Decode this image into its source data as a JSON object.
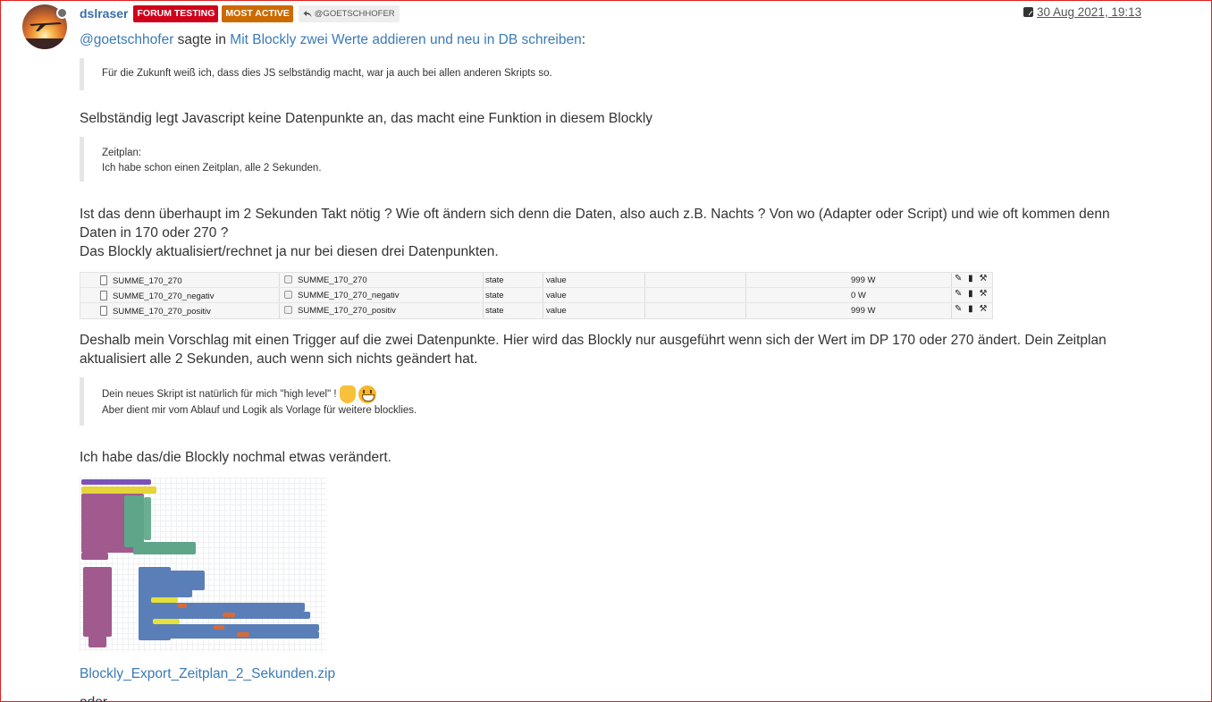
{
  "post": {
    "username": "dslraser",
    "badges": [
      "FORUM TESTING",
      "MOST ACTIVE"
    ],
    "reply_to": "@GOETSCHHOFER",
    "timestamp": "30 Aug 2021, 19:13",
    "mention": "@goetschhofer",
    "mention_middle": "sagte in",
    "thread_link": "Mit Blockly zwei Werte addieren und neu in DB schreiben",
    "mention_suffix": ":",
    "quote1": "Für die Zukunft weiß ich, dass dies JS selbständig macht, war ja auch bei allen anderen Skripts so.",
    "para1": "Selbständig legt Javascript keine Datenpunkte an, das macht eine Funktion in diesem Blockly",
    "quote2_line1": "Zeitplan:",
    "quote2_line2": "Ich habe schon einen Zeitplan, alle 2 Sekunden.",
    "para2_line1": "Ist das denn überhaupt im 2 Sekunden Takt nötig ? Wie oft ändern sich denn die Daten, also auch z.B. Nachts ? Von wo (Adapter oder Script) und wie oft kommen denn",
    "para2_line2": "Daten in 170 oder 270 ?",
    "para2_line3": "Das Blockly aktualisiert/rechnet ja nur bei diesen drei Datenpunkten.",
    "datapoints": [
      {
        "name": "SUMME_170_270",
        "common_name": "SUMME_170_270",
        "type": "state",
        "role": "value",
        "value": "999 W"
      },
      {
        "name": "SUMME_170_270_negativ",
        "common_name": "SUMME_170_270_negativ",
        "type": "state",
        "role": "value",
        "value": "0 W"
      },
      {
        "name": "SUMME_170_270_positiv",
        "common_name": "SUMME_170_270_positiv",
        "type": "state",
        "role": "value",
        "value": "999 W"
      }
    ],
    "para3_line1": "Deshalb mein Vorschlag mit einen Trigger auf die zwei Datenpunkte. Hier wird das Blockly nur ausgeführt wenn sich der Wert im DP 170 oder 270 ändert. Dein Zeitplan",
    "para3_line2": "aktualisiert alle 2 Sekunden, auch wenn sich nichts geändert hat.",
    "quote3_line1": "Dein neues Skript ist natürlich für mich \"high level\" !",
    "quote3_line2": "Aber dient mir vom Ablauf und Logik als Vorlage für weitere blocklies.",
    "para4": "Ich habe das/die Blockly nochmal etwas verändert.",
    "attachment": "Blockly_Export_Zeitplan_2_Sekunden.zip",
    "trailing": "oder"
  },
  "icons": {
    "reply": "reply-arrow-icon",
    "edit": "edit-icon",
    "file": "file-icon",
    "thumbs_up": "thumbs-up-emoji",
    "grin": "grinning-emoji"
  },
  "colors": {
    "link": "#3a7ab7",
    "badge_forum_testing": "#d0021b",
    "badge_most_active": "#cc6a00"
  }
}
